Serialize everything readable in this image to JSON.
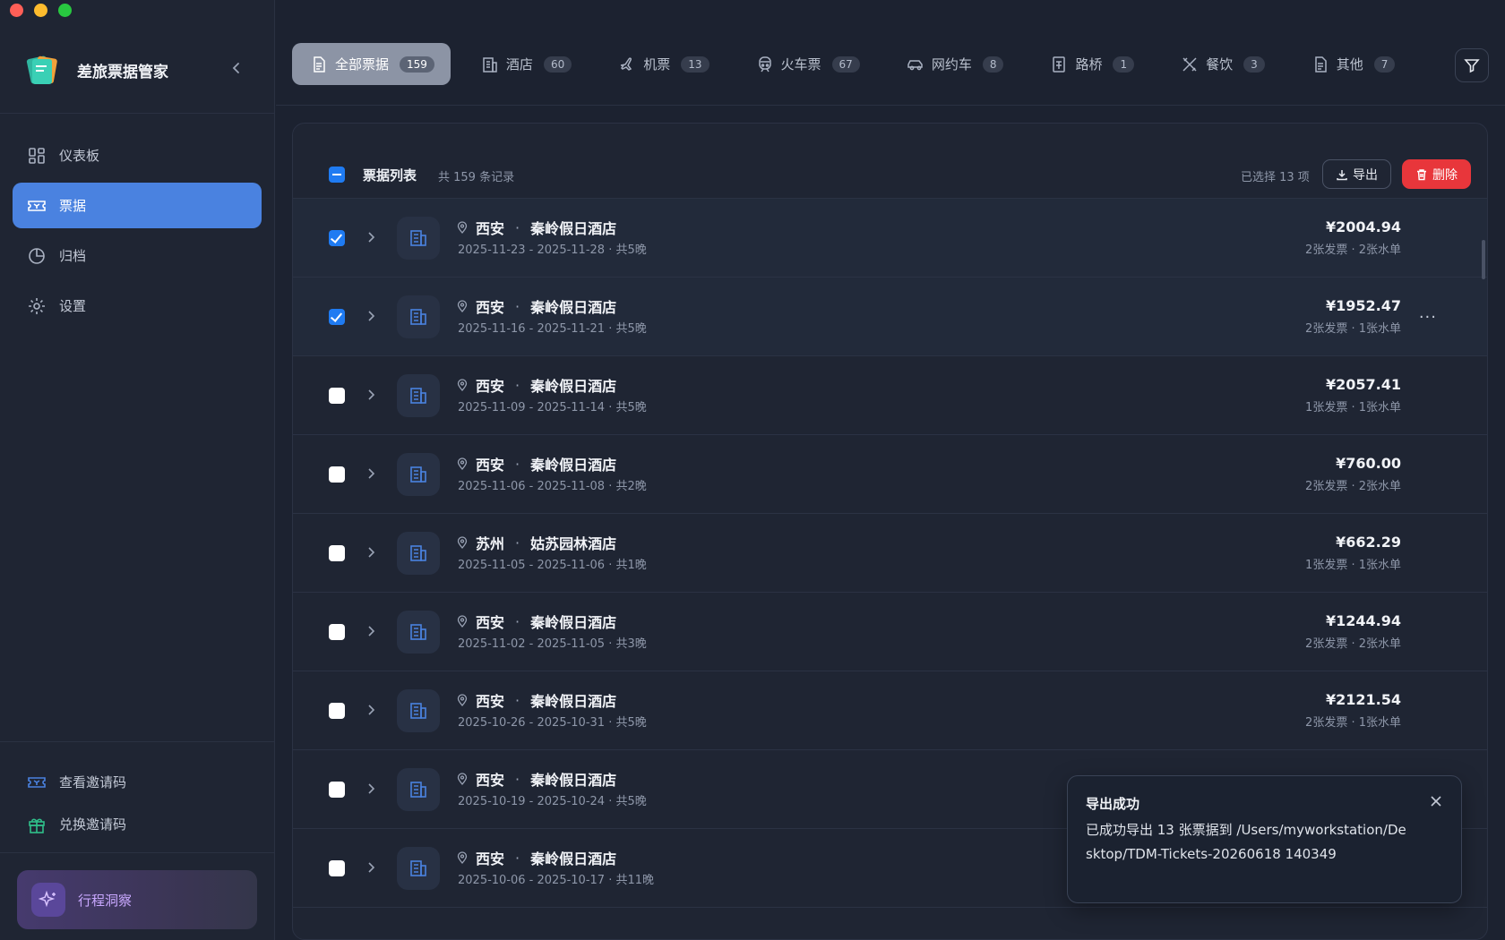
{
  "app": {
    "title": "差旅票据管家"
  },
  "colors": {
    "accent": "#4a82e0",
    "danger": "#e8363b",
    "checkbox": "#1f7bf2",
    "insight": "#c9a8ff"
  },
  "sidebar": {
    "items": [
      {
        "label": "仪表板",
        "icon": "dashboard-icon",
        "active": false
      },
      {
        "label": "票据",
        "icon": "ticket-icon",
        "active": true
      },
      {
        "label": "归档",
        "icon": "pie-chart-icon",
        "active": false
      },
      {
        "label": "设置",
        "icon": "gear-icon",
        "active": false
      }
    ],
    "bottom": [
      {
        "label": "查看邀请码",
        "icon": "ticket-icon"
      },
      {
        "label": "兑换邀请码",
        "icon": "gift-icon"
      }
    ],
    "insight_label": "行程洞察"
  },
  "tabs": [
    {
      "label": "全部票据",
      "count": "159",
      "icon": "document-icon"
    },
    {
      "label": "酒店",
      "count": "60",
      "icon": "hotel-icon"
    },
    {
      "label": "机票",
      "count": "13",
      "icon": "plane-icon"
    },
    {
      "label": "火车票",
      "count": "67",
      "icon": "train-icon"
    },
    {
      "label": "网约车",
      "count": "8",
      "icon": "car-icon"
    },
    {
      "label": "路桥",
      "count": "1",
      "icon": "toll-icon"
    },
    {
      "label": "餐饮",
      "count": "3",
      "icon": "utensils-icon"
    },
    {
      "label": "其他",
      "count": "7",
      "icon": "document-icon"
    }
  ],
  "list": {
    "title": "票据列表",
    "count_text": "共 159 条记录",
    "selected_text": "已选择 13 项",
    "export_label": "导出",
    "delete_label": "删除",
    "rows": [
      {
        "city": "西安",
        "hotel": "秦岭假日酒店",
        "dates": "2025-11-23 - 2025-11-28 · 共5晚",
        "amount": "¥2004.94",
        "meta": "2张发票 · 2张水单",
        "selected": true
      },
      {
        "city": "西安",
        "hotel": "秦岭假日酒店",
        "dates": "2025-11-16 - 2025-11-21 · 共5晚",
        "amount": "¥1952.47",
        "meta": "2张发票 · 1张水单",
        "selected": true,
        "more": "···"
      },
      {
        "city": "西安",
        "hotel": "秦岭假日酒店",
        "dates": "2025-11-09 - 2025-11-14 · 共5晚",
        "amount": "¥2057.41",
        "meta": "1张发票 · 1张水单",
        "selected": false
      },
      {
        "city": "西安",
        "hotel": "秦岭假日酒店",
        "dates": "2025-11-06 - 2025-11-08 · 共2晚",
        "amount": "¥760.00",
        "meta": "2张发票 · 2张水单",
        "selected": false
      },
      {
        "city": "苏州",
        "hotel": "姑苏园林酒店",
        "dates": "2025-11-05 - 2025-11-06 · 共1晚",
        "amount": "¥662.29",
        "meta": "1张发票 · 1张水单",
        "selected": false
      },
      {
        "city": "西安",
        "hotel": "秦岭假日酒店",
        "dates": "2025-11-02 - 2025-11-05 · 共3晚",
        "amount": "¥1244.94",
        "meta": "2张发票 · 2张水单",
        "selected": false
      },
      {
        "city": "西安",
        "hotel": "秦岭假日酒店",
        "dates": "2025-10-26 - 2025-10-31 · 共5晚",
        "amount": "¥2121.54",
        "meta": "2张发票 · 1张水单",
        "selected": false
      },
      {
        "city": "西安",
        "hotel": "秦岭假日酒店",
        "dates": "2025-10-19 - 2025-10-24 · 共5晚",
        "amount": "",
        "meta": "",
        "selected": false
      },
      {
        "city": "西安",
        "hotel": "秦岭假日酒店",
        "dates": "2025-10-06 - 2025-10-17 · 共11晚",
        "amount": "",
        "meta": "",
        "selected": false
      }
    ]
  },
  "toast": {
    "title": "导出成功",
    "message": "已成功导出 13 张票据到 /Users/myworkstation/Desktop/TDM-Tickets-20260618 140349"
  }
}
